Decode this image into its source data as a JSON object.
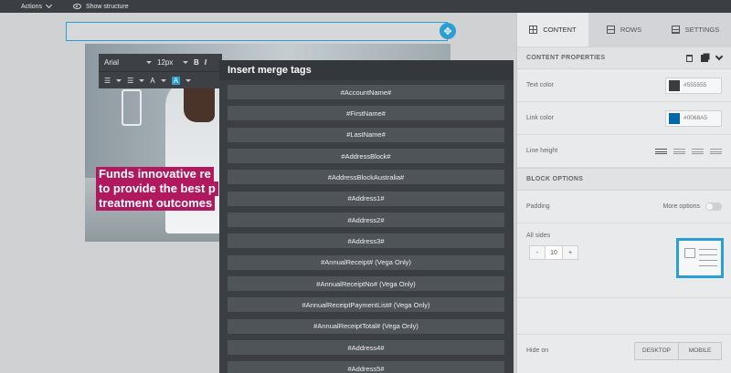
{
  "topbar": {
    "actions_label": "Actions",
    "show_structure_label": "Show structure"
  },
  "toolbar": {
    "font_family": "Arial",
    "font_size": "12px",
    "bold": "B",
    "italic": "I",
    "font_color_label": "A",
    "highlight_label": "A"
  },
  "hero": {
    "headline_lines": [
      "Funds innovative re",
      "to provide the best p",
      "treatment outcomes"
    ],
    "headline_bg": "#b0195e"
  },
  "merge_tags": {
    "title": "Insert merge tags",
    "items": [
      "#AccountName#",
      "#FirstName#",
      "#LastName#",
      "#AddressBlock#",
      "#AddressBlockAustralia#",
      "#Address1#",
      "#Address2#",
      "#Address3#",
      "#AnnualReceipt# (Vega Only)",
      "#AnnualReceiptNo# (Vega Only)",
      "#AnnualReceiptPaymentList# (Vega Only)",
      "#AnnualReceiptTotal# (Vega Only)",
      "#Address4#",
      "#Address5#"
    ]
  },
  "panel": {
    "tabs": [
      {
        "label": "CONTENT",
        "icon": "grid-icon",
        "active": true
      },
      {
        "label": "ROWS",
        "icon": "rows-icon",
        "active": false
      },
      {
        "label": "SETTINGS",
        "icon": "settings-icon",
        "active": false
      }
    ],
    "content_properties_label": "CONTENT PROPERTIES",
    "text_color": {
      "label": "Text color",
      "value": "#555555",
      "swatch": "#3c3c3c"
    },
    "link_color": {
      "label": "Link color",
      "value": "#0068A5",
      "swatch": "#0068a5"
    },
    "line_height_label": "Line height",
    "block_options_label": "BLOCK OPTIONS",
    "padding_label": "Padding",
    "more_options_label": "More options",
    "all_sides_label": "All sides",
    "padding_minus": "-",
    "padding_value": "10",
    "padding_plus": "+",
    "hide_on_label": "Hide on",
    "desktop_label": "DESKTOP",
    "mobile_label": "MOBILE"
  },
  "colors": {
    "accent": "#2b9fd4",
    "popup_bg": "#3b3f43"
  }
}
